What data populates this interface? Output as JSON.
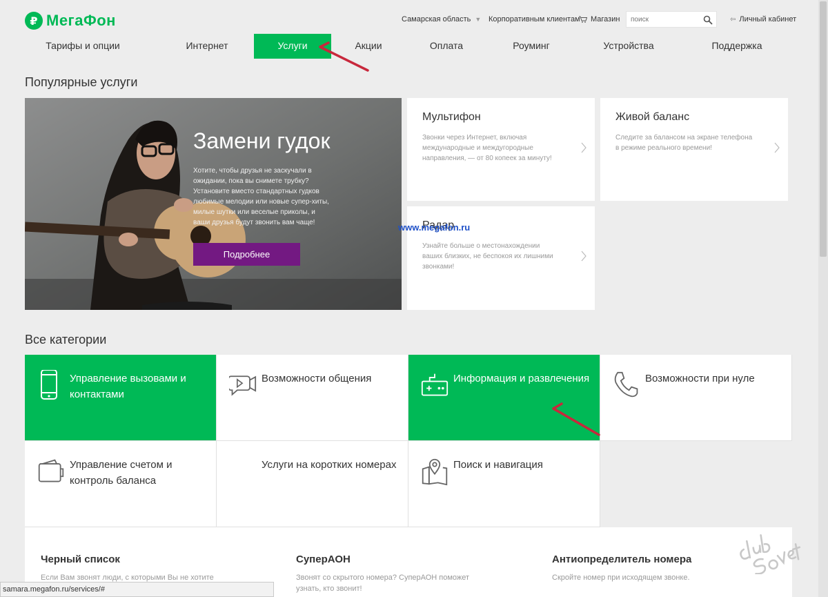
{
  "brand": {
    "name": "МегаФон",
    "color": "#00b956",
    "icon": "megafon-logo-icon"
  },
  "header": {
    "region": "Самарская область",
    "corporate": "Корпоративным клиентам",
    "shop": "Магазин",
    "search_placeholder": "поиск",
    "cabinet": "Личный кабинет"
  },
  "nav": {
    "items": [
      {
        "label": "Тарифы и опции"
      },
      {
        "label": "Интернет"
      },
      {
        "label": "Услуги"
      },
      {
        "label": "Акции"
      },
      {
        "label": "Оплата"
      },
      {
        "label": "Роуминг"
      },
      {
        "label": "Устройства"
      },
      {
        "label": "Поддержка"
      }
    ],
    "active": "Услуги"
  },
  "popular": {
    "heading": "Популярные услуги",
    "banner": {
      "title": "Замени гудок",
      "text": "Хотите, чтобы друзья не заскучали в ожидании, пока вы снимете трубку? Установите вместо стандартных гудков любимые мелодии или новые супер-хиты, милые шутки или веселые приколы, и ваши друзья будут звонить вам чаще!",
      "button": "Подробнее",
      "button_color": "#731982"
    },
    "cards": [
      {
        "title": "Мультифон",
        "desc": "Звонки через Интернет, включая международные и междугородные направления, — от 80 копеек за минуту!"
      },
      {
        "title": "Живой баланс",
        "desc": "Следите за балансом на экране телефона в режиме реального времени!"
      },
      {
        "title": "Радар",
        "desc": "Узнайте больше о местонахождении ваших близких, не беспокоя их лишними звонками!"
      }
    ],
    "watermark": "www.megafon.ru"
  },
  "categories": {
    "heading": "Все категории",
    "items": [
      {
        "label": "Управление вызовами и контактами",
        "icon": "phone-icon"
      },
      {
        "label": "Возможности общения",
        "icon": "video-chat-icon"
      },
      {
        "label": "Информация и развлечения",
        "icon": "gamepad-icon"
      },
      {
        "label": "Возможности при нуле",
        "icon": "handset-icon"
      },
      {
        "label": "Управление счетом и контроль баланса",
        "icon": "wallet-icon"
      },
      {
        "label": "Услуги на коротких номерах",
        "icon": ""
      },
      {
        "label": "Поиск и навигация",
        "icon": "map-pin-icon"
      }
    ]
  },
  "services": [
    {
      "title": "Черный список",
      "desc": "Если Вам звонят люди, с которыми Вы не хотите"
    },
    {
      "title": "СуперАОН",
      "desc": "Звонят со скрытого номера? СуперАОН поможет узнать, кто звонит!"
    },
    {
      "title": "Антиопределитель номера",
      "desc": "Скройте номер при исходящем звонке."
    }
  ],
  "statusbar": "samara.megafon.ru/services/#",
  "stamp": "club Sovet",
  "colors": {
    "green": "#00b956",
    "purple": "#731982",
    "arrow": "#c8283c"
  }
}
